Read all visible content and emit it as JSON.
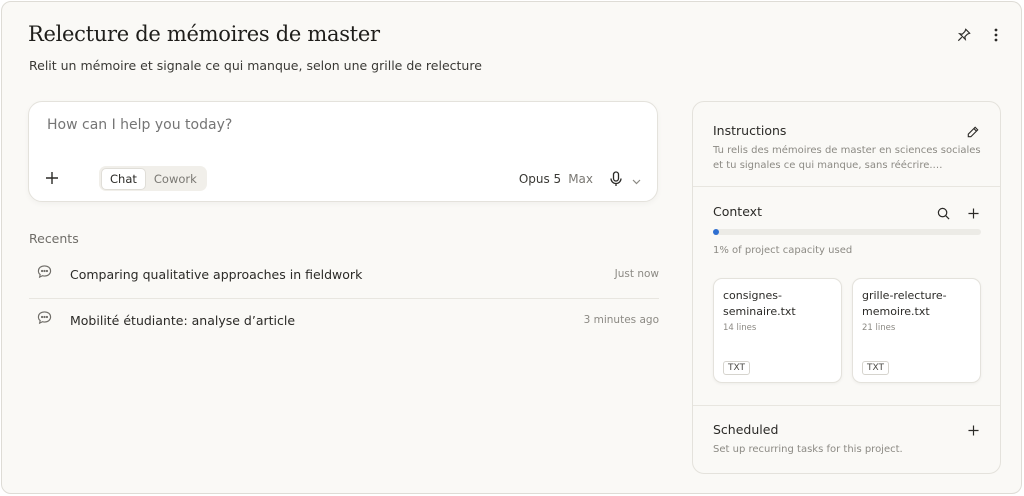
{
  "header": {
    "title": "Relecture de mémoires de master",
    "subtitle": "Relit un mémoire et signale ce qui manque, selon une grille de relecture"
  },
  "composer": {
    "placeholder": "How can I help you today?",
    "modes": [
      "Chat",
      "Cowork"
    ],
    "active_mode": "Chat",
    "model": "Opus 5",
    "effort": "Max"
  },
  "recents": {
    "heading": "Recents",
    "items": [
      {
        "label": "Comparing qualitative approaches in fieldwork",
        "time": "Just now"
      },
      {
        "label": "Mobilité étudiante: analyse d’article",
        "time": "3 minutes ago"
      }
    ]
  },
  "panel": {
    "instructions": {
      "title": "Instructions",
      "text_line1": "Tu relis des mémoires de master en sciences sociales",
      "text_line2": "et tu signales ce qui manque, sans réécrire.…"
    },
    "context": {
      "title": "Context",
      "capacity_percent": 1,
      "capacity_text": "1% of project capacity used",
      "files": [
        {
          "name_line1": "consignes-",
          "name_line2": "seminaire.txt",
          "lines": "14 lines",
          "type": "TXT"
        },
        {
          "name_line1": "grille-relecture-",
          "name_line2": "memoire.txt",
          "lines": "21 lines",
          "type": "TXT"
        }
      ]
    },
    "scheduled": {
      "title": "Scheduled",
      "text": "Set up recurring tasks for this project."
    }
  },
  "colors": {
    "background": "#faf9f6",
    "accent": "#2f6fd1",
    "border": "#e4e2dc"
  }
}
